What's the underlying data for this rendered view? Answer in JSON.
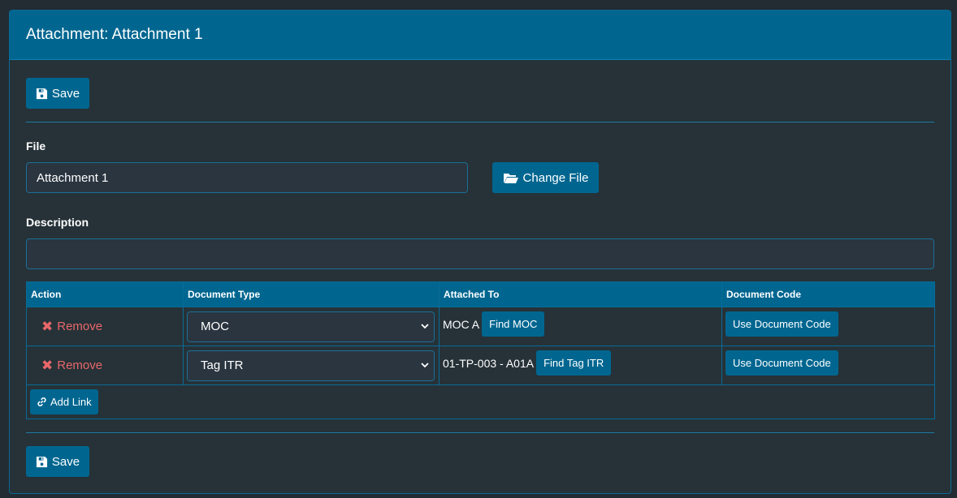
{
  "header": {
    "title": "Attachment: Attachment 1"
  },
  "actions": {
    "save_label": "Save",
    "save_bottom_label": "Save"
  },
  "file": {
    "label": "File",
    "value": "Attachment 1",
    "change_label": "Change File"
  },
  "description": {
    "label": "Description",
    "value": ""
  },
  "table": {
    "columns": [
      "Action",
      "Document Type",
      "Attached To",
      "Document Code"
    ],
    "rows": [
      {
        "remove_label": "Remove",
        "document_type": "MOC",
        "attached_to": "MOC A",
        "find_label": "Find MOC",
        "doc_code_label": "Use Document Code"
      },
      {
        "remove_label": "Remove",
        "document_type": "Tag ITR",
        "attached_to": "01-TP-003 - A01A",
        "find_label": "Find Tag ITR",
        "doc_code_label": "Use Document Code"
      }
    ],
    "add_link_label": "Add Link"
  },
  "colors": {
    "accent": "#006690",
    "background": "#232b33",
    "panel": "#263238",
    "remove": "#e8676a"
  },
  "icons": {
    "save": "floppy-disk-icon",
    "change_file": "folder-open-icon",
    "remove": "times-icon",
    "dropdown": "chevron-down-icon",
    "add_link": "link-icon"
  }
}
